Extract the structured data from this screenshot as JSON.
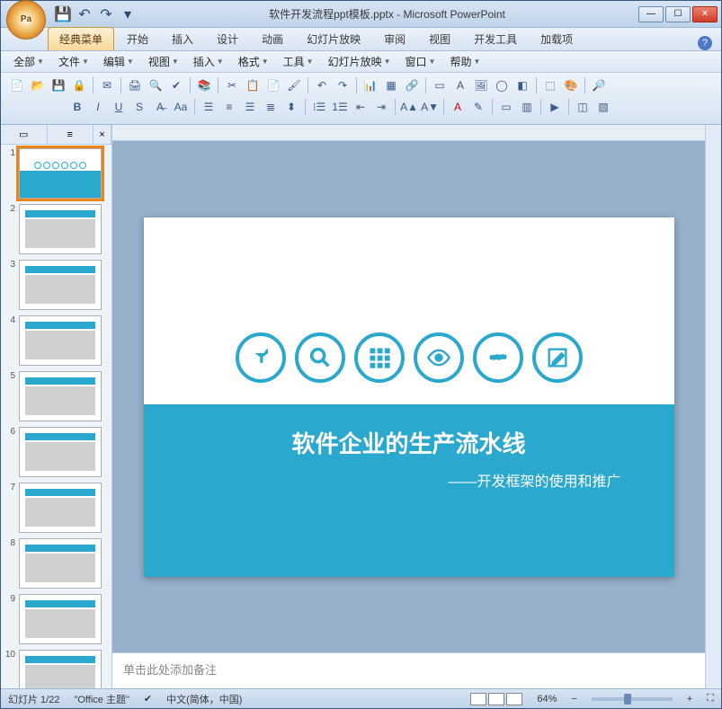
{
  "window": {
    "title": "软件开发流程ppt模板.pptx - Microsoft PowerPoint"
  },
  "ribbon_tabs": [
    "经典菜单",
    "开始",
    "插入",
    "设计",
    "动画",
    "幻灯片放映",
    "审阅",
    "视图",
    "开发工具",
    "加载项"
  ],
  "active_tab": 0,
  "menus": [
    "全部",
    "文件",
    "编辑",
    "视图",
    "插入",
    "格式",
    "工具",
    "幻灯片放映",
    "窗口",
    "帮助"
  ],
  "outline": {
    "close_label": "×",
    "slides": [
      1,
      2,
      3,
      4,
      5,
      6,
      7,
      8,
      9,
      10
    ],
    "active": 1
  },
  "slide": {
    "title": "软件企业的生产流水线",
    "subtitle": "——开发框架的使用和推广",
    "icons": [
      "pin",
      "search",
      "grid",
      "eye",
      "world",
      "edit"
    ]
  },
  "notes": {
    "placeholder": "单击此处添加备注"
  },
  "status": {
    "slide_info": "幻灯片 1/22",
    "theme": "\"Office 主题\"",
    "language": "中文(简体，中国)",
    "zoom": "64%"
  }
}
